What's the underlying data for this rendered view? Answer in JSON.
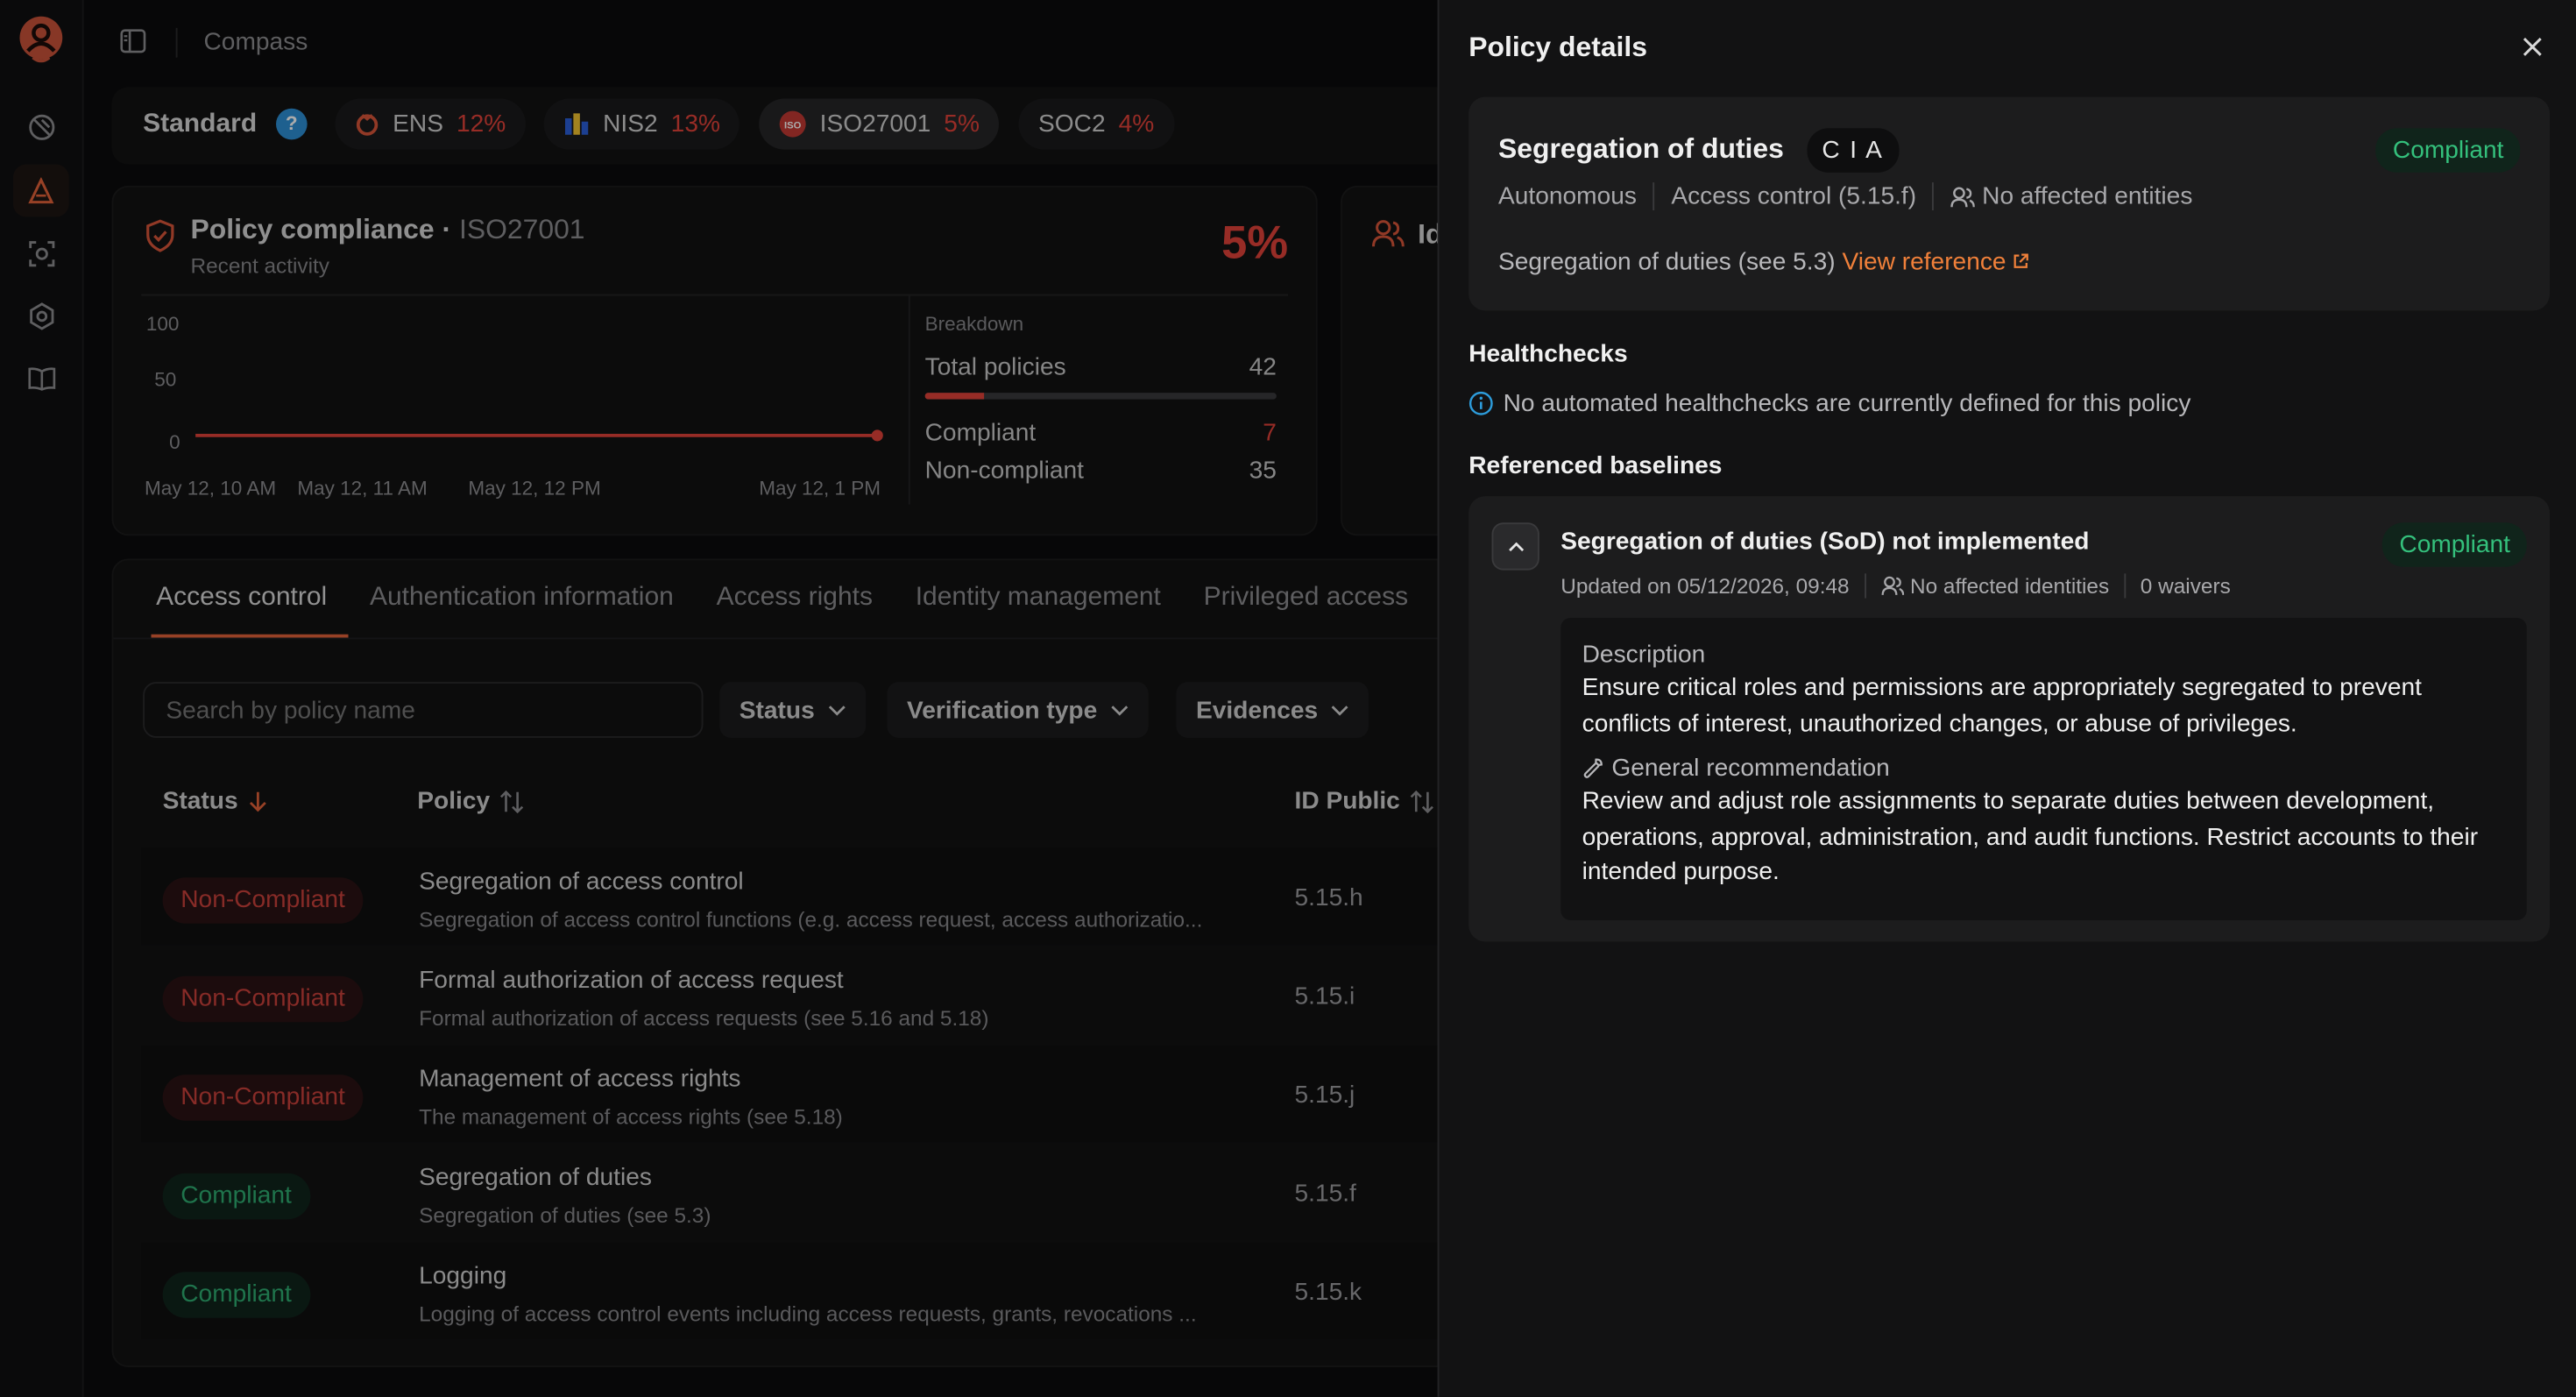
{
  "rail": {
    "items": [
      "security-icon",
      "alerts-icon",
      "scan-icon",
      "settings-icon",
      "docs-icon"
    ]
  },
  "topbar": {
    "breadcrumb": "Compass"
  },
  "standards": {
    "label": "Standard",
    "help": "?",
    "chips": [
      {
        "name": "ENS",
        "pct": "12%"
      },
      {
        "name": "NIS2",
        "pct": "13%"
      },
      {
        "name": "ISO27001",
        "pct": "5%"
      },
      {
        "name": "SOC2",
        "pct": "4%"
      }
    ]
  },
  "compliance": {
    "title": "Policy compliance",
    "standard": "ISO27001",
    "subtitle": "Recent activity",
    "percent": "5%",
    "breakdown_label": "Breakdown",
    "total_label": "Total policies",
    "total": "42",
    "compliant_label": "Compliant",
    "compliant": "7",
    "noncompliant_label": "Non-compliant",
    "noncompliant": "35",
    "second_card_title": "Id"
  },
  "chart_data": {
    "type": "line",
    "x": [
      "May 12, 10 AM",
      "May 12, 11 AM",
      "May 12, 12 PM",
      "May 12, 1 PM"
    ],
    "x_tick_labels": [
      "May 12, 10 AM",
      "May 12, 11 AM",
      "May 12, 12 PM",
      "May 12, 1 PM"
    ],
    "y_ticks": [
      "100",
      "50",
      "0"
    ],
    "ylim": [
      0,
      100
    ],
    "series": [
      {
        "values": [
          0,
          0,
          0,
          0
        ],
        "color": "#e2423a"
      }
    ]
  },
  "tabs": [
    "Access control",
    "Authentication information",
    "Access rights",
    "Identity management",
    "Privileged access"
  ],
  "filters": {
    "search_placeholder": "Search by policy name",
    "status": "Status",
    "verification": "Verification type",
    "evidences": "Evidences"
  },
  "table": {
    "headers": {
      "status": "Status",
      "policy": "Policy",
      "id": "ID Public"
    },
    "rows": [
      {
        "status": "Non-Compliant",
        "title": "Segregation of access control",
        "desc": "Segregation of access control functions (e.g. access request, access authorizatio...",
        "id": "5.15.h"
      },
      {
        "status": "Non-Compliant",
        "title": "Formal authorization of access request",
        "desc": "Formal authorization of access requests (see 5.16 and 5.18)",
        "id": "5.15.i"
      },
      {
        "status": "Non-Compliant",
        "title": "Management of access rights",
        "desc": "The management of access rights (see 5.18)",
        "id": "5.15.j"
      },
      {
        "status": "Compliant",
        "title": "Segregation of duties",
        "desc": "Segregation of duties (see 5.3)",
        "id": "5.15.f"
      },
      {
        "status": "Compliant",
        "title": "Logging",
        "desc": "Logging of access control events including access requests, grants, revocations ...",
        "id": "5.15.k"
      }
    ]
  },
  "drawer": {
    "title": "Policy details",
    "policy": {
      "name": "Segregation of duties",
      "cia": "C I A",
      "status": "Compliant",
      "mode": "Autonomous",
      "control": "Access control (5.15.f)",
      "entities": "No affected entities",
      "reference_text": "Segregation of duties (see 5.3)",
      "reference_link": "View reference"
    },
    "healthchecks_title": "Healthchecks",
    "healthchecks_text": "No automated healthchecks are currently defined for this policy",
    "baselines_title": "Referenced baselines",
    "baseline": {
      "title": "Segregation of duties (SoD) not implemented",
      "status": "Compliant",
      "updated": "Updated on 05/12/2026, 09:48",
      "identities": "No affected identities",
      "waivers": "0 waivers",
      "desc_label": "Description",
      "desc": "Ensure critical roles and permissions are appropriately segregated to prevent conflicts of interest, unauthorized changes, or abuse of privileges.",
      "rec_label": "General recommendation",
      "rec": "Review and adjust role assignments to separate duties between development, operations, approval, administration, and audit functions. Restrict accounts to their intended purpose."
    }
  }
}
